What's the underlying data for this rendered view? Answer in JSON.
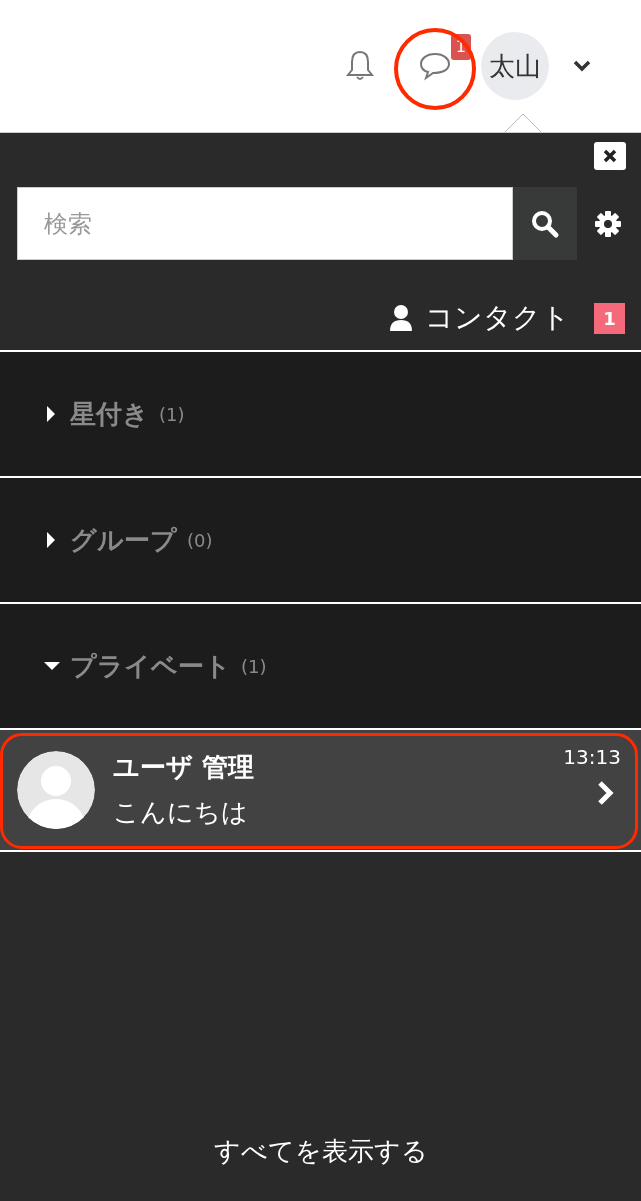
{
  "header": {
    "message_badge": "1",
    "user_initials": "太山"
  },
  "panel": {
    "search": {
      "placeholder": "検索"
    },
    "contacts": {
      "label": "コンタクト",
      "badge": "1"
    },
    "sections": [
      {
        "label": "星付き",
        "count": "(1)",
        "expanded": false
      },
      {
        "label": "グループ",
        "count": "(0)",
        "expanded": false
      },
      {
        "label": "プライベート",
        "count": "(1)",
        "expanded": true
      }
    ],
    "conversations": [
      {
        "name": "ユーザ 管理",
        "message": "こんにちは",
        "time": "13:13"
      }
    ],
    "footer_link": "すべてを表示する"
  }
}
